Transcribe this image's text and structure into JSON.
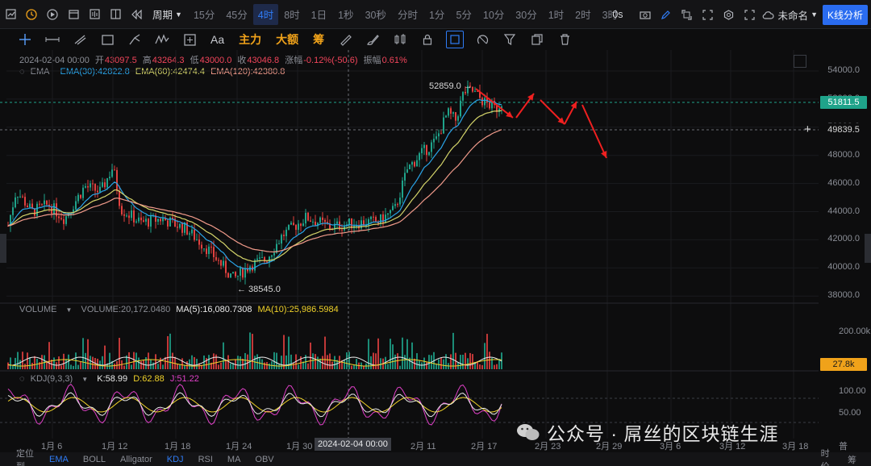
{
  "topbar": {
    "icons": [
      "chart-type-icon",
      "clock-icon",
      "replay-icon",
      "calendar-icon",
      "indicator-icon",
      "layout-icon",
      "rewind-icon"
    ],
    "period_label": "周期",
    "intervals": [
      "15分",
      "45分",
      "4时",
      "8时",
      "1日",
      "1秒",
      "30秒",
      "分时",
      "1分",
      "5分",
      "10分",
      "30分",
      "1时",
      "2时",
      "3时"
    ],
    "active_interval": "4时",
    "right_time": "0s",
    "layout_name": "未命名",
    "kline_button": "K线分析"
  },
  "toolbar": {
    "text_tools": {
      "aa": "Aa",
      "main": "主力",
      "large": "大额",
      "chip": "筹"
    }
  },
  "ohlc": {
    "datetime": "2024-02-04 00:00",
    "open_label": "开",
    "open": "43097.5",
    "high_label": "高",
    "high": "43264.3",
    "low_label": "低",
    "low": "43000.0",
    "close_label": "收",
    "close": "43046.8",
    "change_label": "涨幅",
    "change": "-0.12%(-50.6)",
    "amp_label": "振幅",
    "amp": "0.61%"
  },
  "ema": {
    "name": "EMA",
    "ema30": "EMA(30):42822.8",
    "ema60": "EMA(60):42474.4",
    "ema120": "EMA(120):42380.8"
  },
  "price_axis": [
    "54000.0",
    "52000.0",
    "50000.0",
    "48000.0",
    "46000.0",
    "44000.0",
    "42000.0",
    "40000.0",
    "38000.0"
  ],
  "current_price": "51811.5",
  "crosshair_price": "49839.5",
  "high_marker": "52859.0 →",
  "low_marker": "← 38545.0",
  "volume": {
    "label": "VOLUME",
    "value": "VOLUME:20,172.0480",
    "ma5": "MA(5):16,080.7308",
    "ma10": "MA(10):25,986.5984",
    "axis": "200.00k",
    "current": "27.8k"
  },
  "kdj": {
    "label": "KDJ(9,3,3)",
    "k": "K:58.99",
    "d": "D:62.88",
    "j": "J:51.22",
    "axis": [
      "100.00",
      "50.00"
    ]
  },
  "x_axis": [
    "1月 6",
    "1月 12",
    "1月 18",
    "1月 24",
    "1月 30",
    "2月 11",
    "2月 17",
    "2月 23",
    "2月 29",
    "3月 6",
    "3月 12",
    "3月 18"
  ],
  "x_selected": "2024-02-04 00:00",
  "x_right": "普",
  "bottom": [
    "定位到",
    "EMA",
    "BOLL",
    "Alligator",
    "KDJ",
    "RSI",
    "MA",
    "OBV",
    "时价",
    "筹"
  ],
  "watermark": "公众号 · 屌丝的区块链生涯",
  "colors": {
    "up": "#1fa38a",
    "down": "#e2413f",
    "accent": "#2f7cf6",
    "bg": "#0d0d0e",
    "arrow": "#f02020"
  }
}
